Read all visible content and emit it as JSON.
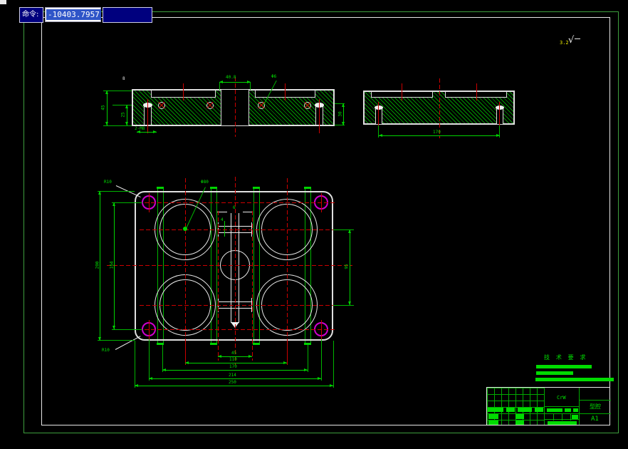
{
  "command_bar": {
    "label": "命令:",
    "value": "-10403.7957"
  },
  "surface_finish": {
    "value": "3.2",
    "symbol": "√"
  },
  "drawing": {
    "section_view_1": {
      "dims": {
        "top_width": "40.8",
        "left_height": "45",
        "left_inner": "25",
        "left_top": "8",
        "hole_note": "2-M8",
        "leader": "Φ6",
        "right_depth": "30"
      }
    },
    "section_view_2": {
      "dims": {
        "hole_span": "170"
      }
    },
    "plan_view": {
      "dims": {
        "bottom": [
          "45",
          "110",
          "170",
          "214",
          "250"
        ],
        "left_outer": "200",
        "left_inner": "164",
        "right": "95",
        "runner_width": "6",
        "runner_arm": "4"
      },
      "leaders": {
        "corner_radius_top": "R10",
        "corner_radius_bottom": "R10",
        "cavity_diameter": "Φ80"
      }
    },
    "tech_requirements": {
      "title": "技 术 要 求"
    },
    "title_block": {
      "material": "CrW",
      "part_name": "型腔",
      "sheet_size": "A1"
    }
  },
  "colors": {
    "frame_green": "#3d9e3d",
    "dim_green": "#00d400",
    "hatch_green": "#009800",
    "centerline_red": "#cc0000",
    "hole_magenta": "#cf00cf",
    "command_navy": "#00007e",
    "selection_blue": "#2f55c8"
  }
}
